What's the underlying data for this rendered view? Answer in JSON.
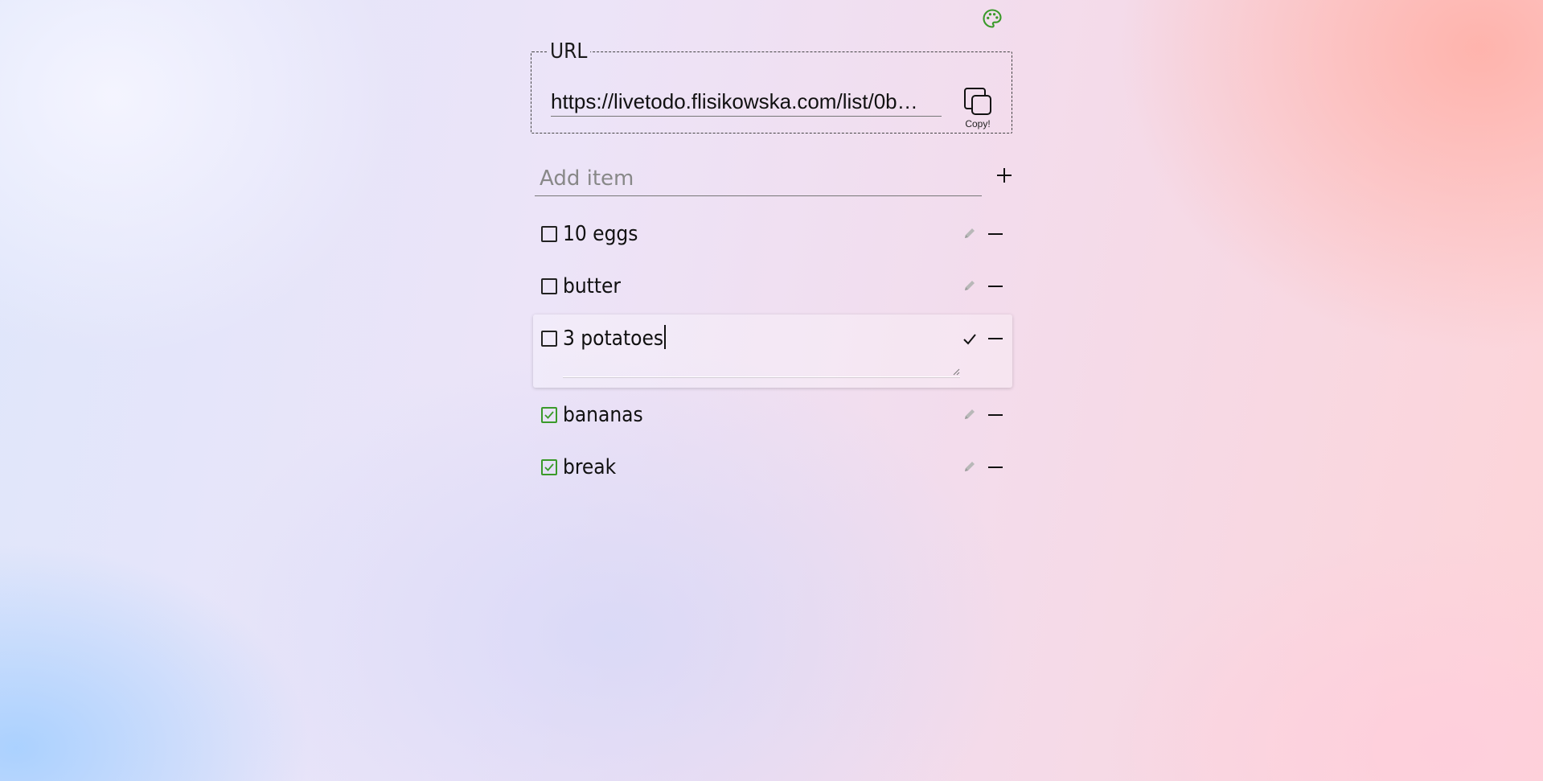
{
  "theme_button": {
    "icon": "palette-icon",
    "color": "#3a9a2a"
  },
  "share": {
    "legend": "URL",
    "url_value": "https://livetodo.flisikowska.com/list/0b…",
    "copy_label": "Copy!",
    "copy_icon": "copy-icon"
  },
  "add_item": {
    "placeholder": "Add item",
    "button_icon": "plus-icon"
  },
  "items": [
    {
      "label": "10 eggs",
      "checked": false,
      "editing": false
    },
    {
      "label": "butter",
      "checked": false,
      "editing": false
    },
    {
      "label": "3 potatoes",
      "checked": false,
      "editing": true
    },
    {
      "label": "bananas",
      "checked": true,
      "editing": false
    },
    {
      "label": "break",
      "checked": true,
      "editing": false
    }
  ],
  "colors": {
    "checked_accent": "#3a9a2a",
    "edit_icon": "#b0b0b0"
  }
}
